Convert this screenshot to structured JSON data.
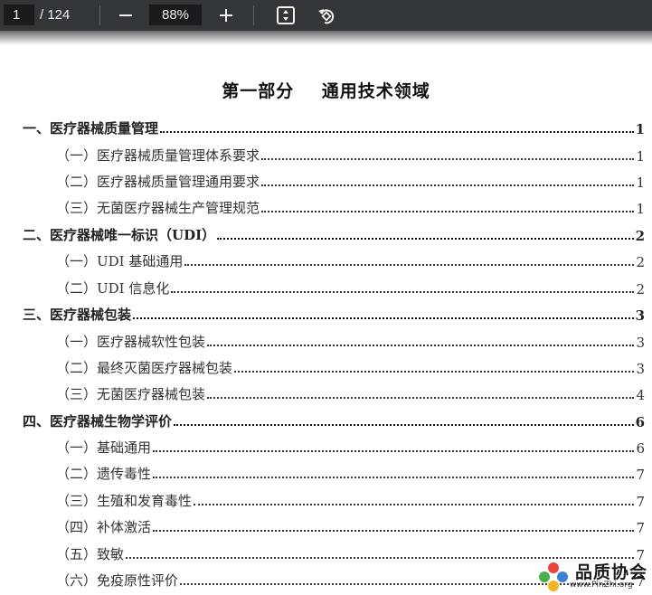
{
  "toolbar": {
    "current_page": "1",
    "total_pages": "/ 124",
    "zoom": "88%",
    "icons": [
      "minus-icon",
      "plus-icon",
      "fit-page-icon",
      "rotate-icon"
    ]
  },
  "document": {
    "title": "第一部分    通用技术领域",
    "toc": [
      {
        "level": 1,
        "text": "一、医疗器械质量管理",
        "page": "1"
      },
      {
        "level": 2,
        "text": "（一）医疗器械质量管理体系要求",
        "page": "1"
      },
      {
        "level": 2,
        "text": "（二）医疗器械质量管理通用要求",
        "page": "1"
      },
      {
        "level": 2,
        "text": "（三）无菌医疗器械生产管理规范",
        "page": "1"
      },
      {
        "level": 1,
        "text": "二、医疗器械唯一标识（UDI）",
        "page": "2"
      },
      {
        "level": 2,
        "text": "（一）UDI 基础通用",
        "page": "2"
      },
      {
        "level": 2,
        "text": "（二）UDI 信息化",
        "page": "2"
      },
      {
        "level": 1,
        "text": "三、医疗器械包装",
        "page": "3"
      },
      {
        "level": 2,
        "text": "（一）医疗器械软性包装",
        "page": "3"
      },
      {
        "level": 2,
        "text": "（二）最终灭菌医疗器械包装",
        "page": "3"
      },
      {
        "level": 2,
        "text": "（三）无菌医疗器械包装",
        "page": "4"
      },
      {
        "level": 1,
        "text": "四、医疗器械生物学评价",
        "page": "6"
      },
      {
        "level": 2,
        "text": "（一）基础通用",
        "page": "6"
      },
      {
        "level": 2,
        "text": "（二）遗传毒性",
        "page": "7"
      },
      {
        "level": 2,
        "text": "（三）生殖和发育毒性",
        "page": "7"
      },
      {
        "level": 2,
        "text": "（四）补体激活",
        "page": "7"
      },
      {
        "level": 2,
        "text": "（五）致敏",
        "page": "7"
      },
      {
        "level": 2,
        "text": "（六）免疫原性评价",
        "page": "7"
      }
    ]
  },
  "watermark": {
    "name": "品质协会",
    "url": "www.PinZhi.org"
  }
}
